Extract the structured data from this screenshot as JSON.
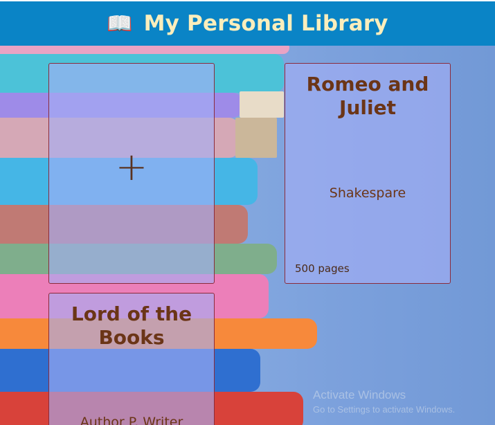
{
  "header": {
    "icon": "open-book-icon",
    "icon_glyph": "📖",
    "title": "My Personal Library"
  },
  "add_card": {
    "icon": "plus-icon",
    "glyph": "+"
  },
  "books": [
    {
      "title": "Romeo and Juliet",
      "author": "Shakespare",
      "pages": "500 pages"
    },
    {
      "title": "Lord of the Books",
      "author": "Author P. Writer",
      "pages": ""
    }
  ],
  "watermark": {
    "line1": "Activate Windows",
    "line2": "Go to Settings to activate Windows."
  },
  "colors": {
    "header_bg": "#0a84c6",
    "header_text": "#fbeebc",
    "card_border": "#8a2b3b",
    "card_text": "#6b3517"
  }
}
